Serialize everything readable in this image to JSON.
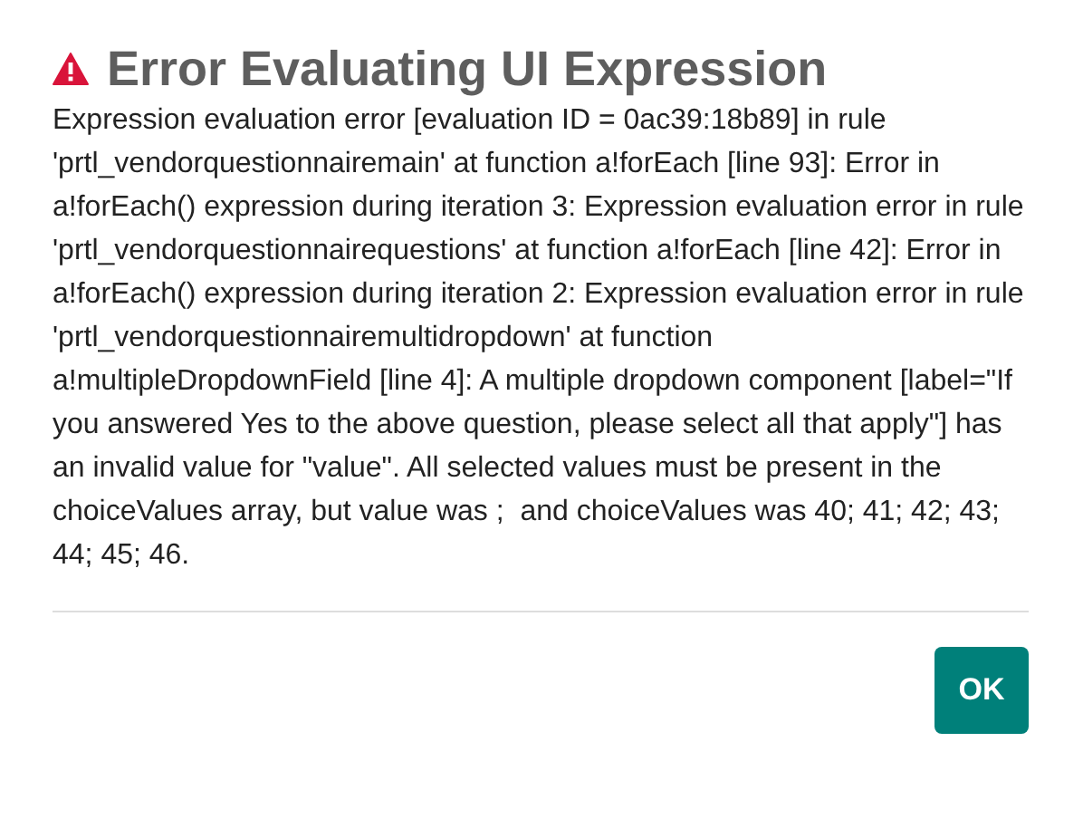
{
  "dialog": {
    "title": "Error Evaluating UI Expression",
    "message": "Expression evaluation error [evaluation ID = 0ac39:18b89] in rule 'prtl_vendorquestionnairemain' at function a!forEach [line 93]: Error in a!forEach() expression during iteration 3: Expression evaluation error in rule 'prtl_vendorquestionnairequestions' at function a!forEach [line 42]: Error in a!forEach() expression during iteration 2: Expression evaluation error in rule 'prtl_vendorquestionnairemultidropdown' at function a!multipleDropdownField [line 4]: A multiple dropdown component [label=\"If you answered Yes to the above question, please select all that apply\"] has an invalid value for \"value\". All selected values must be present in the choiceValues array, but value was ;  and choiceValues was 40; 41; 42; 43; 44; 45; 46.",
    "buttons": [
      "OK"
    ]
  }
}
